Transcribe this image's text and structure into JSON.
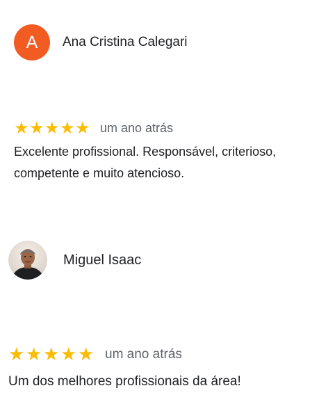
{
  "reviews": [
    {
      "author": "Ana Cristina Calegari",
      "avatar_letter": "A",
      "avatar_color": "#f25b22",
      "rating": 5,
      "date": "um ano atrás",
      "text": "Excelente profissional. Responsável, criterioso, competente e muito atencioso."
    },
    {
      "author": "Miguel Isaac",
      "avatar_letter": "",
      "rating": 5,
      "date": "um ano atrás",
      "text": "Um dos melhores profissionais da área!"
    }
  ],
  "colors": {
    "star": "#fbbc04",
    "meta_text": "#5f6368",
    "body_text": "#202124"
  }
}
